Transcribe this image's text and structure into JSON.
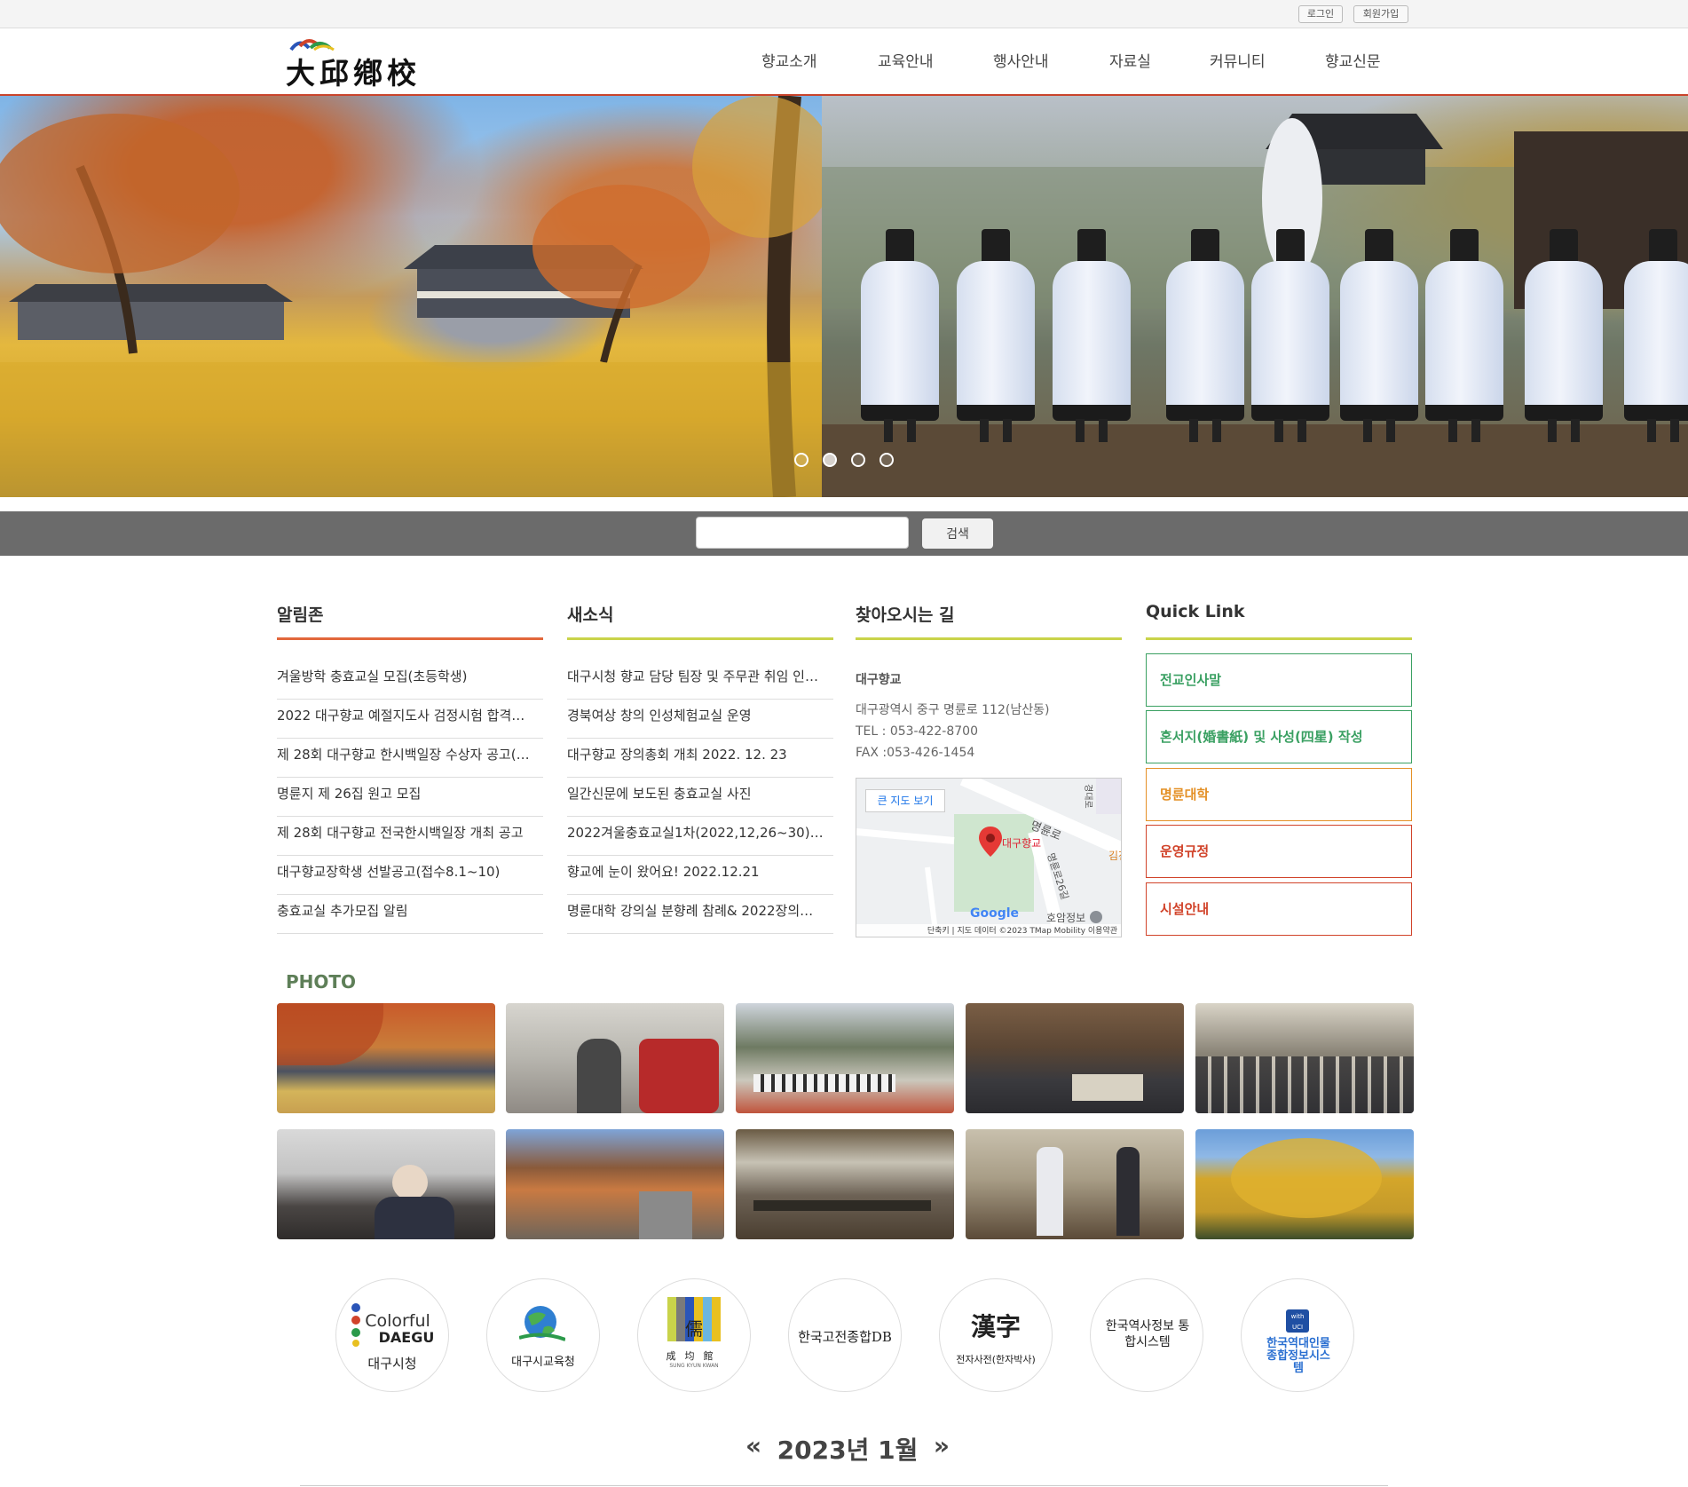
{
  "topbar": {
    "login_label": "로그인",
    "signup_label": "회원가입"
  },
  "header": {
    "logo_text": "大邱鄕校",
    "nav": [
      "향교소개",
      "교육안내",
      "행사안내",
      "자료실",
      "커뮤니티",
      "향교신문"
    ]
  },
  "hero": {
    "slide_count": 4,
    "active_slide": 2
  },
  "search": {
    "value": "",
    "button_label": "검색"
  },
  "notice": {
    "title": "알림존",
    "items": [
      "겨울방학 충효교실 모집(초등학생)",
      "2022 대구향교 예절지도사 검정시험 합격…",
      "제 28회 대구향교 한시백일장 수상자 공고(…",
      "명륜지 제 26집 원고 모집",
      "제 28회 대구향교 전국한시백일장 개최 공고",
      "대구향교장학생 선발공고(접수8.1~10)",
      "충효교실 추가모집 알림"
    ]
  },
  "news": {
    "title": "새소식",
    "items": [
      "대구시청 향교 담당 팀장 및 주무관 취임 인…",
      "경북여상 창의 인성체험교실 운영",
      "대구향교 장의총회 개최 2022. 12. 23",
      "일간신문에 보도된 충효교실 사진",
      "2022겨울충효교실1차(2022,12,26~30)오…",
      "향교에 눈이 왔어요! 2022.12.21",
      "명륜대학 강의실 분향례 참례& 2022장의…"
    ]
  },
  "directions": {
    "title": "찾아오시는 길",
    "name": "대구향교",
    "address": "대구광역시 중구 명륜로 112(남산동)",
    "tel": "TEL : 053-422-8700",
    "fax": "FAX :053-426-1454",
    "map": {
      "big_map_label": "큰 지도 보기",
      "marker_label": "대구향교",
      "road_label_1": "명륜로",
      "road_label_2": "명륜로26길",
      "road_label_3": "경대로",
      "place_label": "호암정보",
      "edge_label": "김진",
      "google_label": "Google",
      "footer_label": "단축키 | 지도 데이터 ©2023 TMap Mobility   이용약관"
    }
  },
  "quicklink": {
    "title": "Quick Link",
    "items": [
      {
        "label": "전교인사말",
        "color": "#3aa062"
      },
      {
        "label": "혼서지(婚書紙) 및 사성(四星) 작성",
        "color": "#3aa062"
      },
      {
        "label": "명륜대학",
        "color": "#e49026"
      },
      {
        "label": "운영규정",
        "color": "#d1432a"
      },
      {
        "label": "시설안내",
        "color": "#d1432a"
      }
    ]
  },
  "photo": {
    "title": "PHOTO"
  },
  "links": [
    {
      "label": "대구시청",
      "logo_top": "Colorful",
      "logo_bottom": "DAEGU"
    },
    {
      "label": "대구시교육청"
    },
    {
      "label": "成均館",
      "sub": "SUNG KYUN KWAN",
      "glyph": "儒"
    },
    {
      "label": "한국고전종합DB"
    },
    {
      "label": "전자사전(한자박사)",
      "glyph": "漢字"
    },
    {
      "label": "한국역사정보 통합시스템"
    },
    {
      "label": "한국역대인물 종합정보시스템",
      "badge": "with UCI"
    }
  ],
  "calendar": {
    "title": "2023년 1월",
    "prev": "«",
    "next": "»"
  },
  "colors": {
    "accent_red": "#c9442c",
    "notice_line": "#e2673b",
    "news_line": "#c9d34a",
    "directions_line": "#c9d34a",
    "quicklink_line": "#c9d34a",
    "search_bar": "#6b6b6b",
    "photo_title": "#5e7f58"
  }
}
